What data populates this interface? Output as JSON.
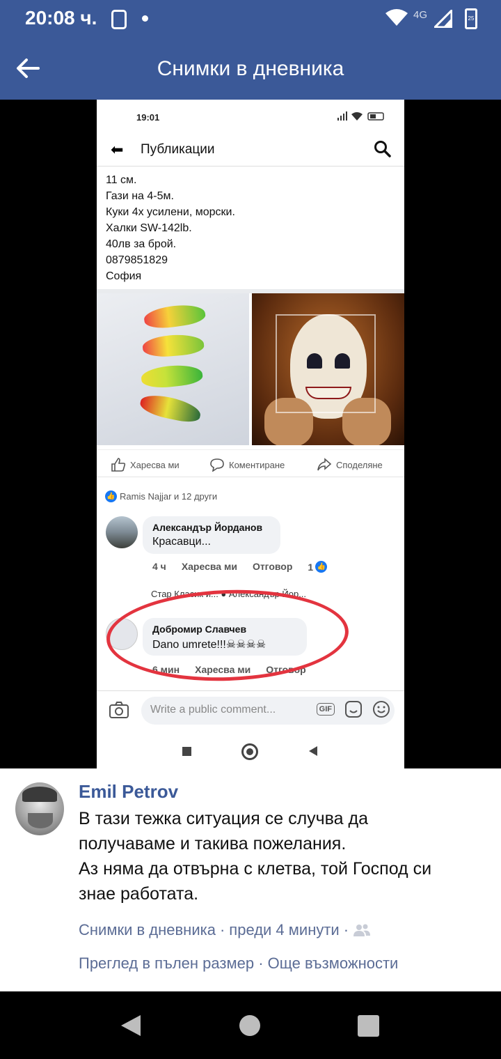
{
  "status_bar": {
    "time": "20:08 ч.",
    "network": "4G",
    "battery": "25"
  },
  "app_bar": {
    "title": "Снимки в дневника"
  },
  "photo": {
    "inner_status_time": "19:01",
    "inner_header_title": "Публикации",
    "post_lines": [
      "11 см.",
      "Гази на 4-5м.",
      "Куки 4х усилени, морски.",
      "Халки  SW-142lb.",
      "40лв за брой.",
      "0879851829",
      "София"
    ],
    "actions": {
      "like": "Харесва ми",
      "comment": "Коментиране",
      "share": "Споделяне"
    },
    "likes_summary": "Ramis Najjar и 12 други",
    "comment1": {
      "author": "Александър Йорданов",
      "text": "Красавци...",
      "time": "4 ч",
      "like": "Харесва ми",
      "reply": "Отговор",
      "reactions": "1"
    },
    "reply_preview": "Стар Класик и... ● Александър Йор...",
    "comment2": {
      "author": "Добромир Славчев",
      "text": "Dano umrete!!!☠☠☠☠",
      "time": "6 мин",
      "like": "Харесва ми",
      "reply": "Отговор"
    },
    "composer_placeholder": "Write a public comment...",
    "gif_label": "GIF"
  },
  "caption": {
    "author": "Emil Petrov",
    "text_lines": [
      "В тази тежка ситуация се случва да",
      "получаваме и такива пожелания.",
      "Аз няма да отвърна с клетва, той Господ си",
      "знае работата."
    ],
    "album": "Снимки в дневника",
    "separator": "·",
    "time": "преди 4 минути",
    "view_full": "Преглед в пълен размер",
    "more_options": "Още възможности"
  },
  "colors": {
    "header": "#3b5998",
    "link": "#5b6c95",
    "highlight": "#e3343f"
  },
  "icons": [
    "back-arrow-icon",
    "wifi-icon",
    "signal-icon",
    "battery-icon",
    "search-icon",
    "like-icon",
    "comment-icon",
    "share-icon",
    "camera-icon",
    "gif-icon",
    "sticker-icon",
    "emoji-icon",
    "friends-icon"
  ]
}
